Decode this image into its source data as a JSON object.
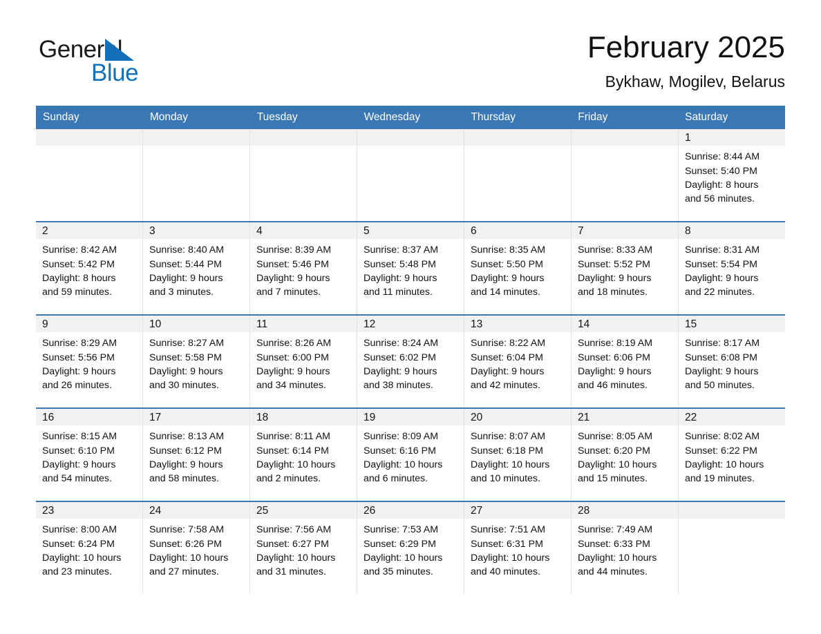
{
  "brand": {
    "name_part1": "General",
    "name_part2": "Blue",
    "flag_icon": "blue-triangle-flag",
    "color_black": "#1a1a1a",
    "color_blue": "#1270b8"
  },
  "header": {
    "month_title": "February 2025",
    "location": "Bykhaw, Mogilev, Belarus",
    "accent_color": "#3a77b5"
  },
  "calendar": {
    "weekday_headers": [
      "Sunday",
      "Monday",
      "Tuesday",
      "Wednesday",
      "Thursday",
      "Friday",
      "Saturday"
    ],
    "labels": {
      "sunrise_prefix": "Sunrise:",
      "sunset_prefix": "Sunset:",
      "daylight_prefix": "Daylight:"
    },
    "weeks": [
      [
        {
          "day": "",
          "line1": "",
          "line2": "",
          "line3": "",
          "line4": ""
        },
        {
          "day": "",
          "line1": "",
          "line2": "",
          "line3": "",
          "line4": ""
        },
        {
          "day": "",
          "line1": "",
          "line2": "",
          "line3": "",
          "line4": ""
        },
        {
          "day": "",
          "line1": "",
          "line2": "",
          "line3": "",
          "line4": ""
        },
        {
          "day": "",
          "line1": "",
          "line2": "",
          "line3": "",
          "line4": ""
        },
        {
          "day": "",
          "line1": "",
          "line2": "",
          "line3": "",
          "line4": ""
        },
        {
          "day": "1",
          "line1": "Sunrise: 8:44 AM",
          "line2": "Sunset: 5:40 PM",
          "line3": "Daylight: 8 hours",
          "line4": "and 56 minutes."
        }
      ],
      [
        {
          "day": "2",
          "line1": "Sunrise: 8:42 AM",
          "line2": "Sunset: 5:42 PM",
          "line3": "Daylight: 8 hours",
          "line4": "and 59 minutes."
        },
        {
          "day": "3",
          "line1": "Sunrise: 8:40 AM",
          "line2": "Sunset: 5:44 PM",
          "line3": "Daylight: 9 hours",
          "line4": "and 3 minutes."
        },
        {
          "day": "4",
          "line1": "Sunrise: 8:39 AM",
          "line2": "Sunset: 5:46 PM",
          "line3": "Daylight: 9 hours",
          "line4": "and 7 minutes."
        },
        {
          "day": "5",
          "line1": "Sunrise: 8:37 AM",
          "line2": "Sunset: 5:48 PM",
          "line3": "Daylight: 9 hours",
          "line4": "and 11 minutes."
        },
        {
          "day": "6",
          "line1": "Sunrise: 8:35 AM",
          "line2": "Sunset: 5:50 PM",
          "line3": "Daylight: 9 hours",
          "line4": "and 14 minutes."
        },
        {
          "day": "7",
          "line1": "Sunrise: 8:33 AM",
          "line2": "Sunset: 5:52 PM",
          "line3": "Daylight: 9 hours",
          "line4": "and 18 minutes."
        },
        {
          "day": "8",
          "line1": "Sunrise: 8:31 AM",
          "line2": "Sunset: 5:54 PM",
          "line3": "Daylight: 9 hours",
          "line4": "and 22 minutes."
        }
      ],
      [
        {
          "day": "9",
          "line1": "Sunrise: 8:29 AM",
          "line2": "Sunset: 5:56 PM",
          "line3": "Daylight: 9 hours",
          "line4": "and 26 minutes."
        },
        {
          "day": "10",
          "line1": "Sunrise: 8:27 AM",
          "line2": "Sunset: 5:58 PM",
          "line3": "Daylight: 9 hours",
          "line4": "and 30 minutes."
        },
        {
          "day": "11",
          "line1": "Sunrise: 8:26 AM",
          "line2": "Sunset: 6:00 PM",
          "line3": "Daylight: 9 hours",
          "line4": "and 34 minutes."
        },
        {
          "day": "12",
          "line1": "Sunrise: 8:24 AM",
          "line2": "Sunset: 6:02 PM",
          "line3": "Daylight: 9 hours",
          "line4": "and 38 minutes."
        },
        {
          "day": "13",
          "line1": "Sunrise: 8:22 AM",
          "line2": "Sunset: 6:04 PM",
          "line3": "Daylight: 9 hours",
          "line4": "and 42 minutes."
        },
        {
          "day": "14",
          "line1": "Sunrise: 8:19 AM",
          "line2": "Sunset: 6:06 PM",
          "line3": "Daylight: 9 hours",
          "line4": "and 46 minutes."
        },
        {
          "day": "15",
          "line1": "Sunrise: 8:17 AM",
          "line2": "Sunset: 6:08 PM",
          "line3": "Daylight: 9 hours",
          "line4": "and 50 minutes."
        }
      ],
      [
        {
          "day": "16",
          "line1": "Sunrise: 8:15 AM",
          "line2": "Sunset: 6:10 PM",
          "line3": "Daylight: 9 hours",
          "line4": "and 54 minutes."
        },
        {
          "day": "17",
          "line1": "Sunrise: 8:13 AM",
          "line2": "Sunset: 6:12 PM",
          "line3": "Daylight: 9 hours",
          "line4": "and 58 minutes."
        },
        {
          "day": "18",
          "line1": "Sunrise: 8:11 AM",
          "line2": "Sunset: 6:14 PM",
          "line3": "Daylight: 10 hours",
          "line4": "and 2 minutes."
        },
        {
          "day": "19",
          "line1": "Sunrise: 8:09 AM",
          "line2": "Sunset: 6:16 PM",
          "line3": "Daylight: 10 hours",
          "line4": "and 6 minutes."
        },
        {
          "day": "20",
          "line1": "Sunrise: 8:07 AM",
          "line2": "Sunset: 6:18 PM",
          "line3": "Daylight: 10 hours",
          "line4": "and 10 minutes."
        },
        {
          "day": "21",
          "line1": "Sunrise: 8:05 AM",
          "line2": "Sunset: 6:20 PM",
          "line3": "Daylight: 10 hours",
          "line4": "and 15 minutes."
        },
        {
          "day": "22",
          "line1": "Sunrise: 8:02 AM",
          "line2": "Sunset: 6:22 PM",
          "line3": "Daylight: 10 hours",
          "line4": "and 19 minutes."
        }
      ],
      [
        {
          "day": "23",
          "line1": "Sunrise: 8:00 AM",
          "line2": "Sunset: 6:24 PM",
          "line3": "Daylight: 10 hours",
          "line4": "and 23 minutes."
        },
        {
          "day": "24",
          "line1": "Sunrise: 7:58 AM",
          "line2": "Sunset: 6:26 PM",
          "line3": "Daylight: 10 hours",
          "line4": "and 27 minutes."
        },
        {
          "day": "25",
          "line1": "Sunrise: 7:56 AM",
          "line2": "Sunset: 6:27 PM",
          "line3": "Daylight: 10 hours",
          "line4": "and 31 minutes."
        },
        {
          "day": "26",
          "line1": "Sunrise: 7:53 AM",
          "line2": "Sunset: 6:29 PM",
          "line3": "Daylight: 10 hours",
          "line4": "and 35 minutes."
        },
        {
          "day": "27",
          "line1": "Sunrise: 7:51 AM",
          "line2": "Sunset: 6:31 PM",
          "line3": "Daylight: 10 hours",
          "line4": "and 40 minutes."
        },
        {
          "day": "28",
          "line1": "Sunrise: 7:49 AM",
          "line2": "Sunset: 6:33 PM",
          "line3": "Daylight: 10 hours",
          "line4": "and 44 minutes."
        },
        {
          "day": "",
          "line1": "",
          "line2": "",
          "line3": "",
          "line4": ""
        }
      ]
    ]
  }
}
